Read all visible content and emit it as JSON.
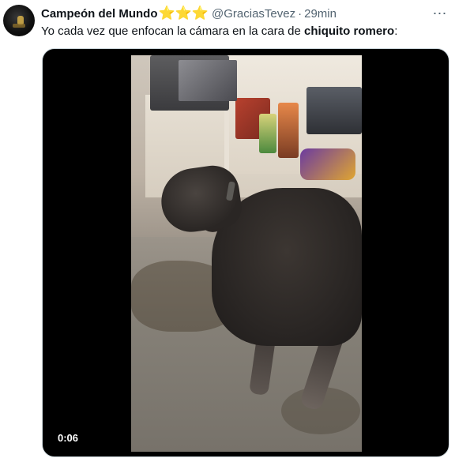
{
  "tweet": {
    "display_name": "Campeón del Mundo",
    "name_emoji": "⭐⭐⭐",
    "handle": "@GraciasTevez",
    "separator": "·",
    "time": "29min",
    "more_icon": "⋯",
    "text_plain": "Yo cada vez que enfocan la cámara en la cara de ",
    "text_bold": "chiquito romero",
    "text_tail": ":"
  },
  "media": {
    "duration": "0:06"
  },
  "colors": {
    "star": "#f4a91c",
    "secondary_text": "#536471",
    "primary_text": "#0f1419"
  }
}
